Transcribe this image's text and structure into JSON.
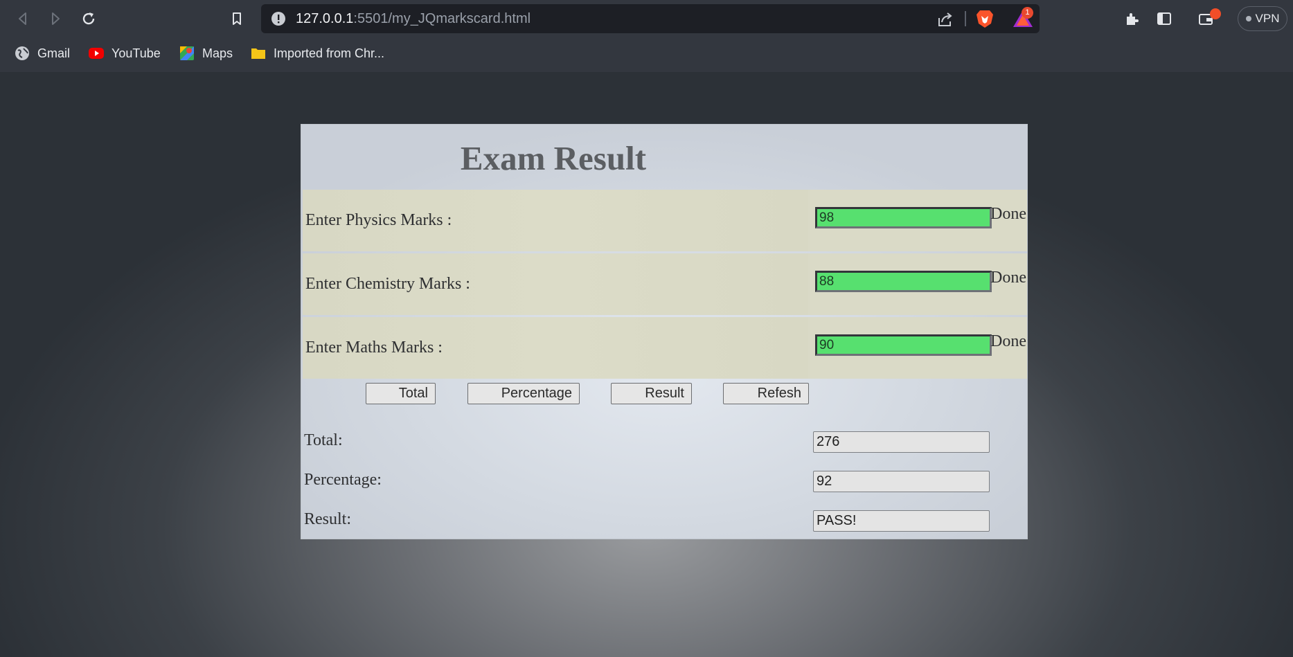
{
  "browser": {
    "url_host": "127.0.0.1",
    "url_rest": ":5501/my_JQmarkscard.html",
    "rewards_badge_count": "1",
    "vpn_label": "VPN",
    "bookmarks": [
      {
        "label": "Gmail",
        "icon": "globe-icon"
      },
      {
        "label": "YouTube",
        "icon": "youtube-icon"
      },
      {
        "label": "Maps",
        "icon": "maps-icon"
      },
      {
        "label": "Imported from Chr...",
        "icon": "folder-icon"
      }
    ]
  },
  "page": {
    "title": "Exam Result",
    "subjects": [
      {
        "label": "Enter Physics Marks :",
        "value": "98",
        "status": "Done"
      },
      {
        "label": "Enter Chemistry Marks :",
        "value": "88",
        "status": "Done"
      },
      {
        "label": "Enter Maths Marks :",
        "value": "90",
        "status": "Done"
      }
    ],
    "buttons": {
      "total": "Total",
      "percentage": "Percentage",
      "result": "Result",
      "refresh": "Refesh"
    },
    "outputs": {
      "total_label": "Total:",
      "total_value": "276",
      "percentage_label": "Percentage:",
      "percentage_value": "92",
      "result_label": "Result:",
      "result_value": "PASS!"
    },
    "colors": {
      "valid_input": "#57e06f",
      "title": "#5b5e62"
    }
  }
}
